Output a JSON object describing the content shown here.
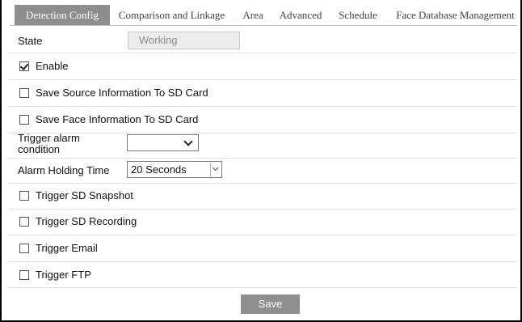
{
  "tabs": [
    {
      "label": "Detection Config",
      "active": true
    },
    {
      "label": "Comparison and Linkage",
      "active": false
    },
    {
      "label": "Area",
      "active": false
    },
    {
      "label": "Advanced",
      "active": false
    },
    {
      "label": "Schedule",
      "active": false
    },
    {
      "label": "Face Database Management",
      "active": false
    }
  ],
  "form": {
    "state_label": "State",
    "state_value": "Working",
    "enable": {
      "label": "Enable",
      "checked": true
    },
    "save_source_info": {
      "label": "Save Source Information To SD Card",
      "checked": false
    },
    "save_face_info": {
      "label": "Save Face Information To SD Card",
      "checked": false
    },
    "trigger_alarm_condition_label_line1": "Trigger alarm",
    "trigger_alarm_condition_label_line2": "condition",
    "trigger_alarm_condition_value": "",
    "alarm_holding_time_label": "Alarm Holding Time",
    "alarm_holding_time_value": "20 Seconds",
    "trigger_sd_snapshot": {
      "label": "Trigger SD Snapshot",
      "checked": false
    },
    "trigger_sd_recording": {
      "label": "Trigger SD Recording",
      "checked": false
    },
    "trigger_email": {
      "label": "Trigger Email",
      "checked": false
    },
    "trigger_ftp": {
      "label": "Trigger FTP",
      "checked": false
    }
  },
  "save_label": "Save",
  "colors": {
    "active_tab_bg": "#8e8e8e",
    "button_bg": "#8f8f8f",
    "divider": "#e1e1e1"
  }
}
